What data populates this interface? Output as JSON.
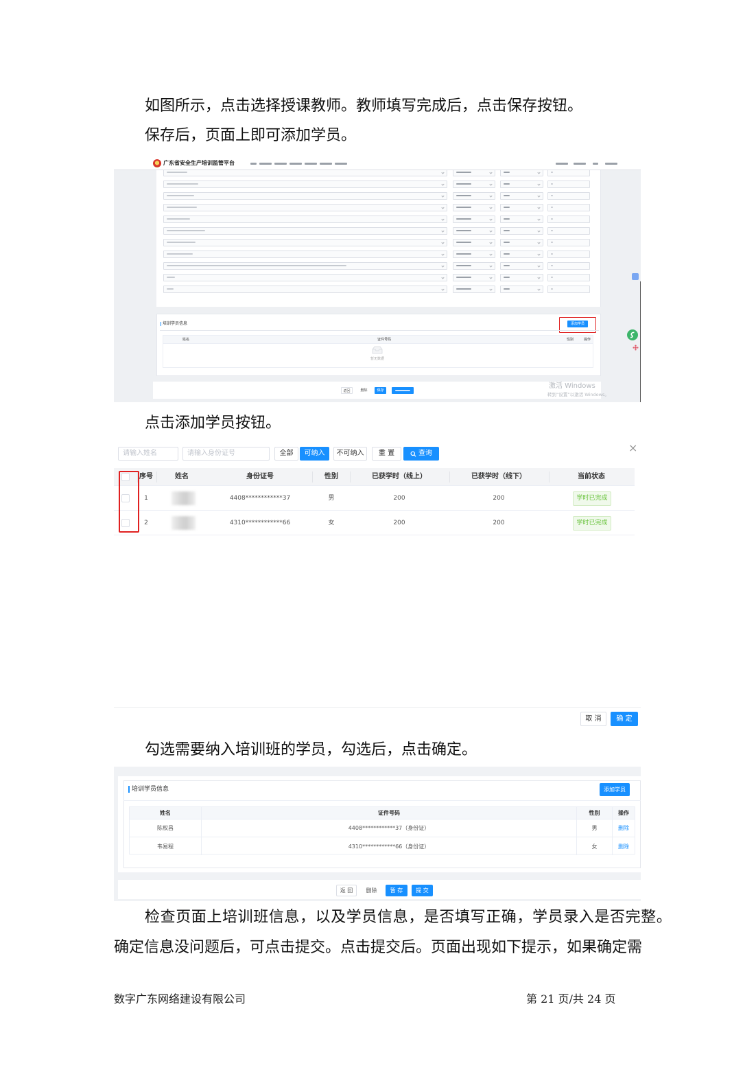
{
  "paragraphs": {
    "p1": "如图所示，点击选择授课教师。教师填写完成后，点击保存按钮。",
    "p2": "保存后，页面上即可添加学员。",
    "p3": "点击添加学员按钮。",
    "p4": "勾选需要纳入培训班的学员，勾选后，点击确定。",
    "p5": "检查页面上培训班信息，以及学员信息，是否填写正确，学员录入是否完整。",
    "p6": "确定信息没问题后，可点击提交。点击提交后。页面出现如下提示，如果确定需"
  },
  "shot1": {
    "app_title": "广东省安全生产培训监管平台",
    "section_title": "培训学员信息",
    "add_button": "添加学员",
    "columns": [
      "姓名",
      "证件号码",
      "性别",
      "操作"
    ],
    "empty_text": "暂无数据",
    "buttons": {
      "back": "返回",
      "delete": "删除",
      "save": "保存"
    },
    "watermark_title": "激活 Windows",
    "watermark_sub": "转到“设置”以激活 Windows。"
  },
  "shot2": {
    "name_placeholder": "请输入姓名",
    "id_placeholder": "请输入身份证号",
    "filters": {
      "all": "全部",
      "eligible": "可纳入",
      "ineligible": "不可纳入",
      "reset": "重 置",
      "search": "查询"
    },
    "close": "×",
    "columns": [
      "序号",
      "姓名",
      "身份证号",
      "性别",
      "已获学时（线上）",
      "已获学时（线下）",
      "当前状态"
    ],
    "rows": [
      {
        "index": "1",
        "id": "4408************37",
        "gender": "男",
        "online": "200",
        "offline": "200",
        "status": "学时已完成"
      },
      {
        "index": "2",
        "id": "4310************66",
        "gender": "女",
        "online": "200",
        "offline": "200",
        "status": "学时已完成"
      }
    ],
    "cancel": "取 消",
    "confirm": "确 定"
  },
  "shot3": {
    "section_title": "培训学员信息",
    "add_button": "添加学员",
    "columns": [
      "姓名",
      "证件号码",
      "性别",
      "操作"
    ],
    "rows": [
      {
        "name": "陈权昌",
        "cert": "4408************37（身份证）",
        "gender": "男",
        "action": "删除"
      },
      {
        "name": "韦易程",
        "cert": "4310************66（身份证）",
        "gender": "女",
        "action": "删除"
      }
    ],
    "buttons": {
      "back": "返 回",
      "delete": "删除",
      "draft": "暂 存",
      "submit": "提 交"
    }
  },
  "footer": {
    "company": "数字广东网络建设有限公司",
    "page": "第 21 页/共 24 页"
  },
  "colors": {
    "primary": "#1890ff",
    "highlight": "#e02020",
    "success": "#67c23a"
  }
}
